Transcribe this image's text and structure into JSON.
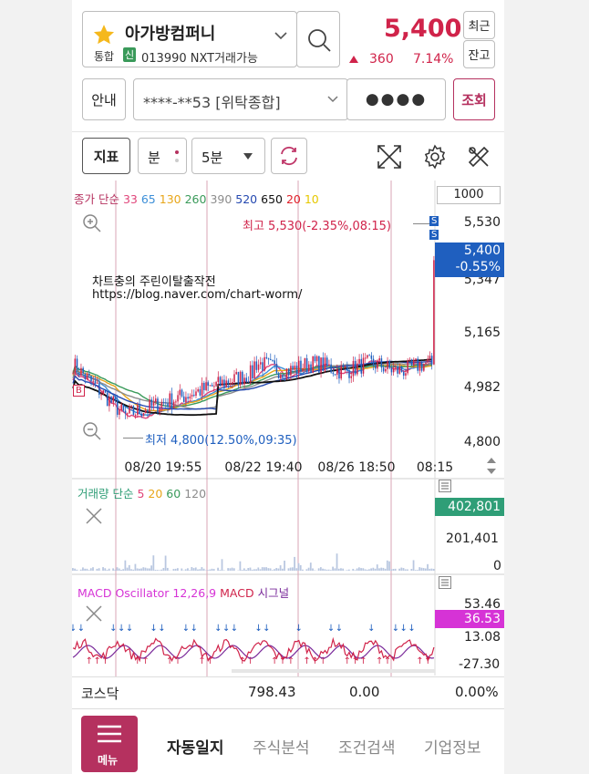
{
  "stock": {
    "name": "아가방컴퍼니",
    "market": "통합",
    "credit_badge": "신",
    "code_info": "013990 NXT거래가능",
    "price": "5,400",
    "change": "360",
    "change_pct": "7.14%",
    "btn_recent": "최근",
    "btn_balance": "잔고"
  },
  "account": {
    "guide_label": "안내",
    "account_number": "****-**53 [위탁종합]",
    "password_mask": "●●●●",
    "query_label": "조회"
  },
  "toolbar": {
    "indicator_label": "지표",
    "period_unit": "분",
    "period_value": "5분"
  },
  "price_chart": {
    "legend_prefix": "종가 단순",
    "ma_periods": [
      {
        "label": "33",
        "color": "#e0457a"
      },
      {
        "label": "65",
        "color": "#3c8fd8"
      },
      {
        "label": "130",
        "color": "#e8a61a"
      },
      {
        "label": "260",
        "color": "#3a9a5a"
      },
      {
        "label": "390",
        "color": "#8c8c8c"
      },
      {
        "label": "520",
        "color": "#2448b0"
      },
      {
        "label": "650",
        "color": "#111111"
      },
      {
        "label": "20",
        "color": "#e0202a"
      },
      {
        "label": "10",
        "color": "#e6c800"
      }
    ],
    "count_box": "1000",
    "y_ticks": [
      "5,530",
      "5,347",
      "5,165",
      "4,982",
      "4,800"
    ],
    "x_ticks": [
      "08/20 19:55",
      "08/22 19:40",
      "08/26 18:50",
      "08:15"
    ],
    "current_price": "5,400",
    "current_change": "-0.55%",
    "high_label": "최고 5,530(-2.35%,08:15)",
    "low_label": "최저 4,800(12.50%,09:35)",
    "marker_b": "B",
    "marker_s": "S",
    "watermark_line1": "차트충의 주린이탈출작전",
    "watermark_line2": "https://blog.naver.com/chart-worm/"
  },
  "volume_chart": {
    "legend_prefix": "거래량 단순",
    "periods": [
      {
        "label": "5",
        "color": "#e0457a"
      },
      {
        "label": "20",
        "color": "#e8a61a"
      },
      {
        "label": "60",
        "color": "#3a9a5a"
      },
      {
        "label": "120",
        "color": "#8c8c8c"
      }
    ],
    "current_value": "402,801",
    "y_ticks": [
      "201,401",
      "0"
    ]
  },
  "macd_chart": {
    "legend_osc": "MACD Oscillator 12,26,9",
    "legend_macd": "MACD",
    "legend_signal": "시그널",
    "current_value": "36.53",
    "y_ticks": [
      "53.46",
      "13.08",
      "-27.30"
    ]
  },
  "index_bar": {
    "name": "코스닥",
    "value": "798.43",
    "change": "0.00",
    "change_pct": "0.00%"
  },
  "bottom_nav": {
    "menu_label": "메뉴",
    "items": [
      "자동일지",
      "주식분석",
      "조건검색",
      "기업정보"
    ]
  },
  "colors": {
    "accent": "#b5315f",
    "up": "#d0234a",
    "down_blue": "#1f5fbf",
    "volume_green": "#2f9e77",
    "macd_magenta": "#d633d6"
  }
}
